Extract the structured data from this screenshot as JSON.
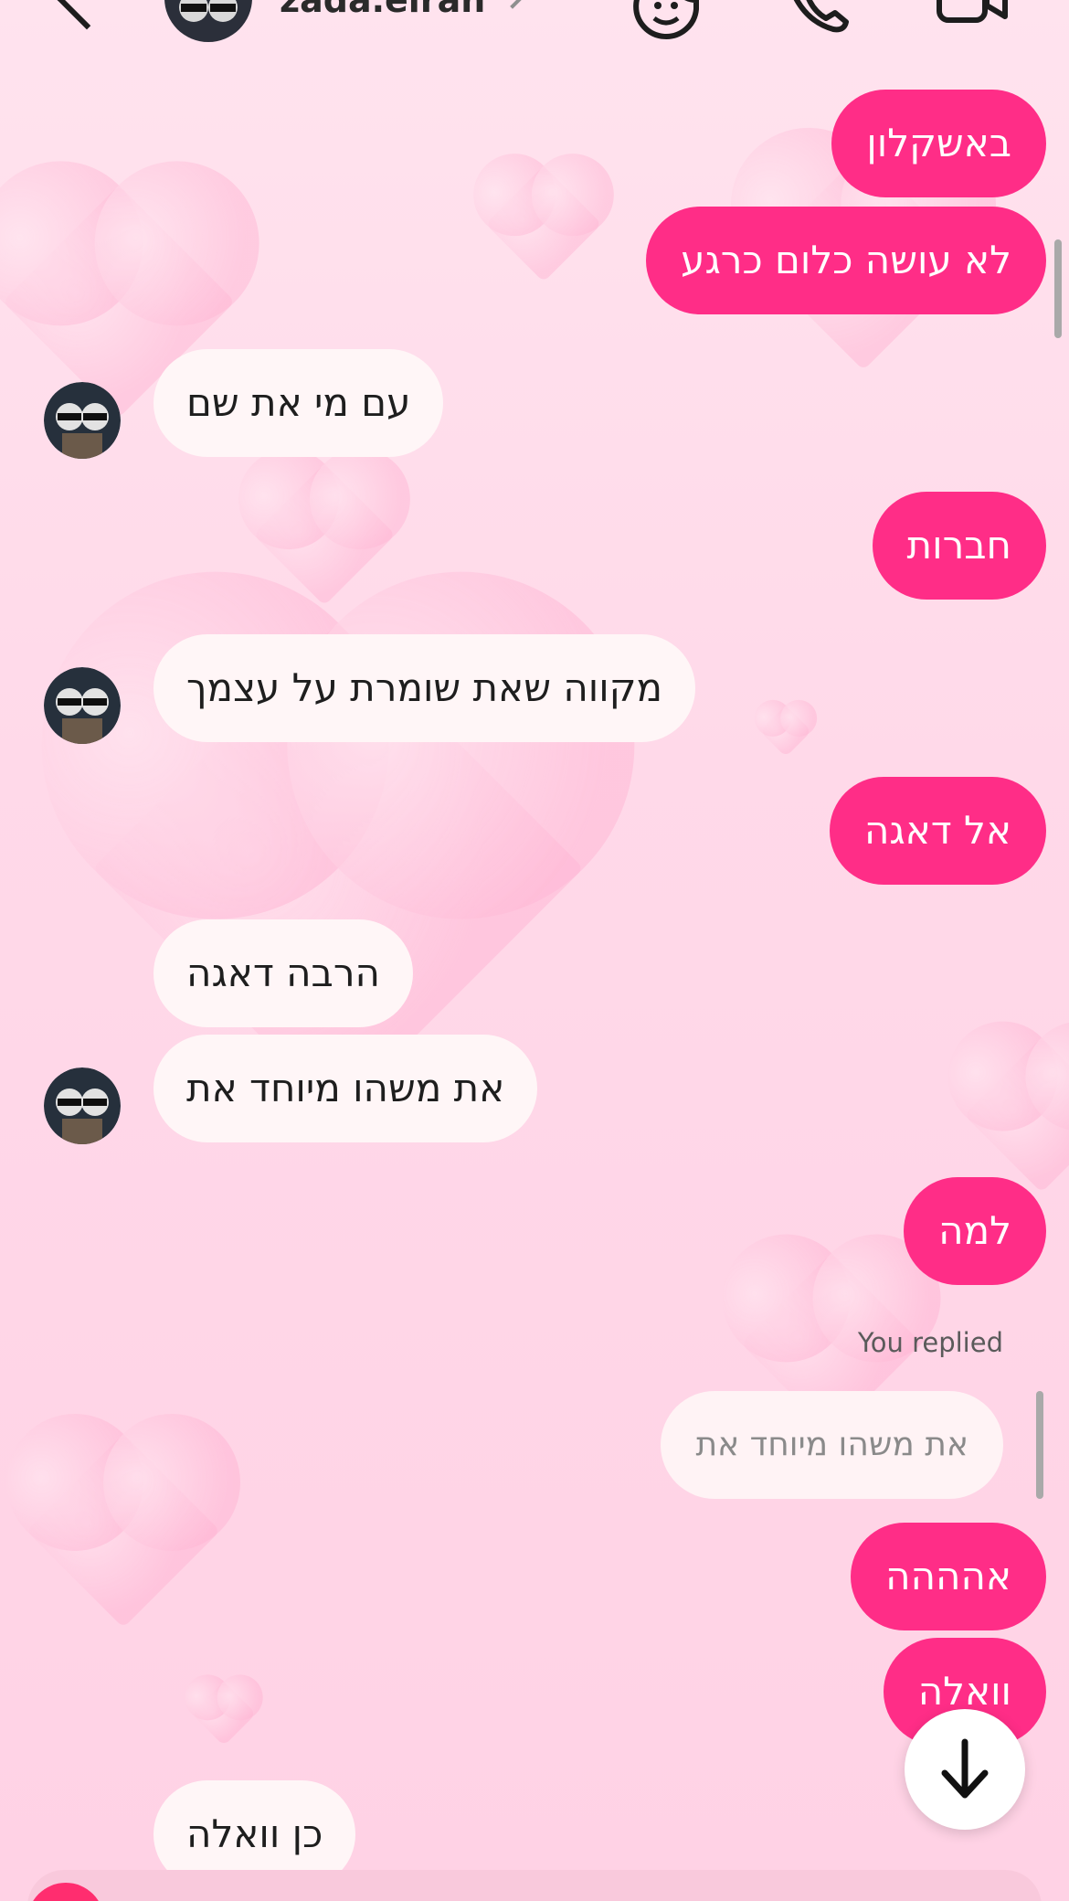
{
  "header": {
    "username": "zada.elran"
  },
  "messages": {
    "m1": "באשקלון",
    "m2": "לא עושה כלום כרגע",
    "m3": "עם מי את שם",
    "m4": "חברות",
    "m5": "מקווה שאת שומרת על עצמך",
    "m6": "אל דאגה",
    "m7": "הרבה דאגה",
    "m8": "את משהו מיוחד את",
    "m9": "למה",
    "replied_label": "You replied",
    "reply_quote": "את משהו מיוחד את",
    "m10": "אהההה",
    "m11": "וואלה",
    "m12": "כן וואלה"
  },
  "colors": {
    "outgoing_bubble": "#ff2d87",
    "incoming_bubble": "#fff6f7",
    "background": "#ffd9e9"
  },
  "icons": [
    "back-icon",
    "chevron-right-icon",
    "sticker-icon",
    "phone-icon",
    "video-icon",
    "arrow-down-icon",
    "camera-icon"
  ]
}
